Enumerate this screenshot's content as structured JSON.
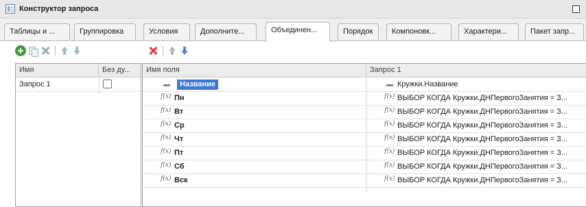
{
  "window": {
    "title": "Конструктор запроса",
    "title_icon": "query-builder-icon",
    "maximize_icon": "maximize-icon"
  },
  "tabs": [
    {
      "label": "Таблицы и ...",
      "active": false
    },
    {
      "label": "Группировка",
      "active": false
    },
    {
      "label": "Условия",
      "active": false
    },
    {
      "label": "Дополните...",
      "active": false
    },
    {
      "label": "Объединен...",
      "active": true
    },
    {
      "label": "Порядок",
      "active": false
    },
    {
      "label": "Компоновк...",
      "active": false
    },
    {
      "label": "Характери...",
      "active": false
    },
    {
      "label": "Пакет запр...",
      "active": false
    }
  ],
  "left_toolbar": [
    "add-icon",
    "copy-icon",
    "delete-icon",
    "move-up-icon",
    "move-down-icon"
  ],
  "right_toolbar": [
    "delete-icon",
    "move-up-icon",
    "move-down-icon"
  ],
  "queries_grid": {
    "columns": [
      "Имя",
      "Без ду..."
    ],
    "rows": [
      {
        "name": "Запрос 1",
        "no_duplicates": false
      }
    ]
  },
  "fields_grid": {
    "columns": [
      "Имя поля",
      "Запрос 1"
    ],
    "rows": [
      {
        "field": "Название",
        "expr": "Кружки.Название",
        "type": "field",
        "selected": true
      },
      {
        "field": "Пн",
        "expr": "ВЫБОР КОГДА Кружки.ДНПервогоЗанятия = З...",
        "type": "expression",
        "selected": false
      },
      {
        "field": "Вт",
        "expr": "ВЫБОР КОГДА Кружки.ДНПервогоЗанятия = З...",
        "type": "expression",
        "selected": false
      },
      {
        "field": "Ср",
        "expr": "ВЫБОР КОГДА Кружки.ДНПервогоЗанятия = З...",
        "type": "expression",
        "selected": false
      },
      {
        "field": "Чт",
        "expr": "ВЫБОР КОГДА Кружки.ДНПервогоЗанятия = З...",
        "type": "expression",
        "selected": false
      },
      {
        "field": "Пт",
        "expr": "ВЫБОР КОГДА Кружки.ДНПервогоЗанятия = З...",
        "type": "expression",
        "selected": false
      },
      {
        "field": "Сб",
        "expr": "ВЫБОР КОГДА Кружки.ДНПервогоЗанятия = З...",
        "type": "expression",
        "selected": false
      },
      {
        "field": "Вск",
        "expr": "ВЫБОР КОГДА Кружки.ДНПервогоЗанятия = З...",
        "type": "expression",
        "selected": false
      }
    ],
    "expression_icon_text": "f(x)"
  }
}
